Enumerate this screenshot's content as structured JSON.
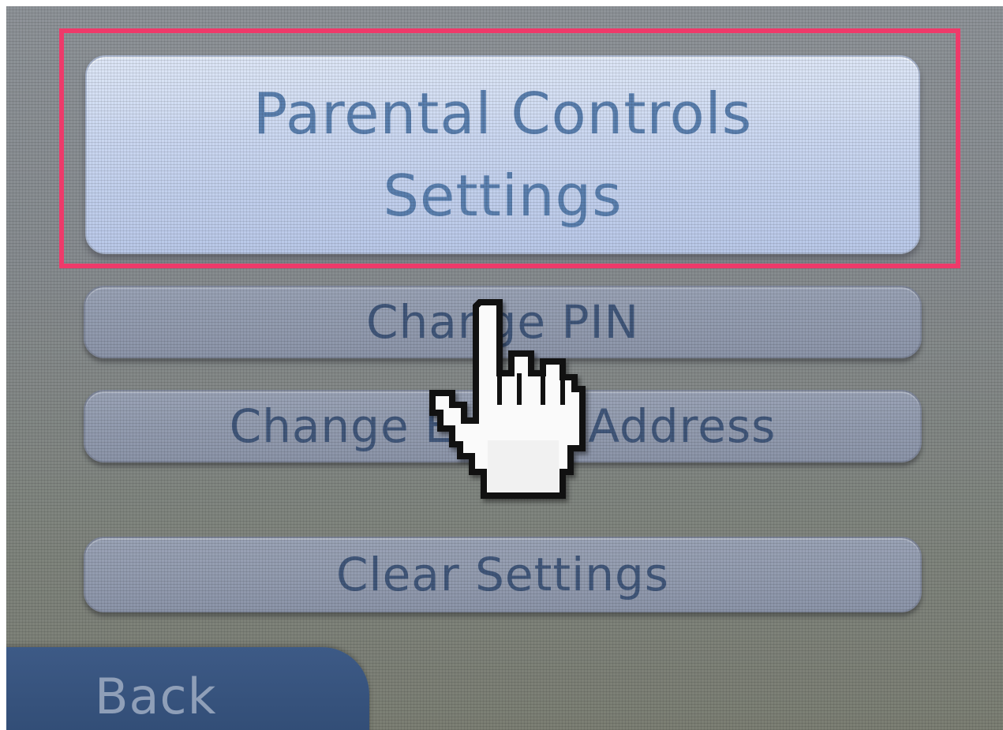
{
  "menu": {
    "parental_controls": {
      "line1": "Parental Controls",
      "line2": "Settings"
    },
    "change_pin": "Change PIN",
    "change_email": "Change E-mail Address",
    "clear_settings": "Clear Settings"
  },
  "footer": {
    "back_label": "Back"
  },
  "colors": {
    "highlight_frame": "#ee3a6a",
    "primary_button": "#c9d6f0",
    "button_text": "#5a7fae",
    "back_tab": "#2f4a72"
  },
  "icons": {
    "pointer": "pointing-hand-cursor-icon"
  }
}
